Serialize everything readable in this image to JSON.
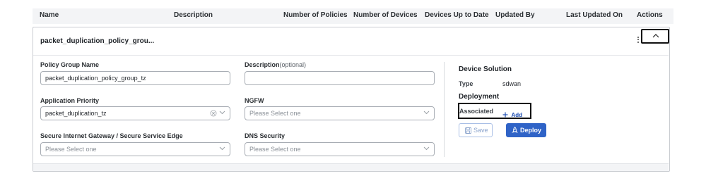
{
  "table": {
    "columns": [
      "Name",
      "Description",
      "Number of Policies",
      "Number of Devices",
      "Devices Up to Date",
      "Updated By",
      "Last Updated On",
      "Actions"
    ]
  },
  "group": {
    "title": "packet_duplication_policy_grou..."
  },
  "form": {
    "policy_group_name": {
      "label": "Policy Group Name",
      "value": "packet_duplication_policy_group_tz"
    },
    "description": {
      "label": "Description",
      "optional": "(optional)",
      "value": ""
    },
    "application_priority": {
      "label": "Application Priority",
      "value": "packet_duplication_tz"
    },
    "ngfw": {
      "label": "NGFW",
      "placeholder": "Please Select one"
    },
    "sig_sse": {
      "label": "Secure Internet Gateway / Secure Service Edge",
      "placeholder": "Please Select one"
    },
    "dns_security": {
      "label": "DNS Security",
      "placeholder": "Please Select one"
    }
  },
  "device_solution": {
    "title": "Device Solution",
    "type_label": "Type",
    "type_value": "sdwan"
  },
  "deployment": {
    "title": "Deployment",
    "associated_label": "Associated",
    "add_label": "Add",
    "save_label": "Save",
    "deploy_label": "Deploy"
  },
  "icons": {
    "collapse": "chevron-up-icon",
    "more": "kebab-menu-icon",
    "clear": "clear-circle-icon",
    "dropdown": "chevron-down-icon",
    "add": "plus-icon",
    "save": "floppy-disk-icon",
    "deploy": "rocket-icon"
  },
  "colors": {
    "accent": "#2f63c7",
    "link": "#1f4fb3"
  }
}
